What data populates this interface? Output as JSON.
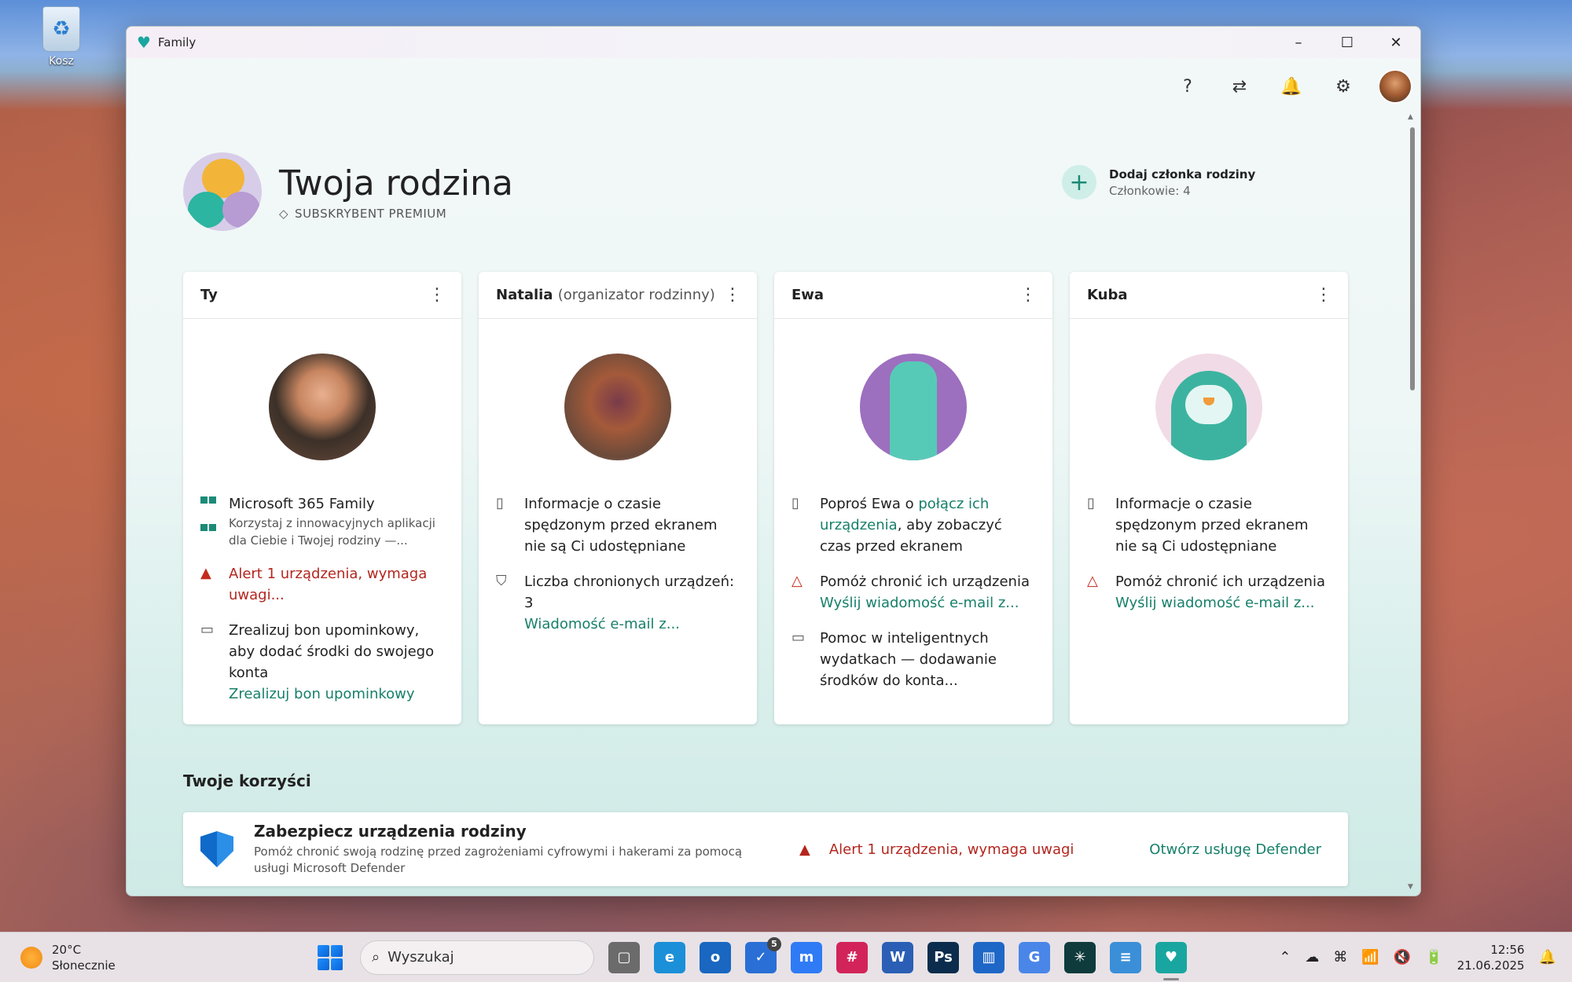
{
  "desktop": {
    "recycle_bin_label": "Kosz"
  },
  "window": {
    "title": "Family",
    "controls": {
      "minimize": "–",
      "maximize": "☐",
      "close": "✕"
    }
  },
  "toolbar": {
    "help_icon": "?",
    "switch_icon": "⇄",
    "bell_icon": "🔔",
    "settings_icon": "⚙"
  },
  "header": {
    "title": "Twoja rodzina",
    "subscription": "SUBSKRYBENT PREMIUM",
    "add_member": {
      "title": "Dodaj członka rodziny",
      "count": "Członkowie: 4",
      "icon": "+"
    }
  },
  "members": [
    {
      "name": "Ty",
      "role": "",
      "items": [
        {
          "title": "Microsoft 365 Family",
          "sub": "Korzystaj z innowacyjnych aplikacji dla Ciebie i Twojej rodziny —..."
        },
        {
          "alert": "Alert 1 urządzenia, wymaga uwagi..."
        },
        {
          "text": "Zrealizuj bon upominkowy, aby dodać środki do swojego konta",
          "link": "Zrealizuj bon upominkowy"
        }
      ]
    },
    {
      "name": "Natalia",
      "role": "(organizator rodzinny)",
      "items": [
        {
          "text": "Informacje o czasie spędzonym przed ekranem nie są Ci udostępniane"
        },
        {
          "text": "Liczba chronionych urządzeń: 3",
          "link": "Wiadomość e-mail z..."
        }
      ]
    },
    {
      "name": "Ewa",
      "role": "",
      "items": [
        {
          "pre": "Poproś Ewa o ",
          "link": "połącz ich urządzenia",
          "post": ", aby zobaczyć czas przed ekranem"
        },
        {
          "text": "Pomóż chronić ich urządzenia",
          "link": "Wyślij wiadomość e-mail z..."
        },
        {
          "text": "Pomoc w inteligentnych wydatkach — dodawanie środków do konta..."
        }
      ]
    },
    {
      "name": "Kuba",
      "role": "",
      "items": [
        {
          "text": "Informacje o czasie spędzonym przed ekranem nie są Ci udostępniane"
        },
        {
          "text": "Pomóż chronić ich urządzenia",
          "link": "Wyślij wiadomość e-mail z..."
        }
      ]
    }
  ],
  "benefits": {
    "title": "Twoje korzyści",
    "card": {
      "title": "Zabezpiecz urządzenia rodziny",
      "desc": "Pomóż chronić swoją rodzinę przed zagrożeniami cyfrowymi i hakerami za pomocą usługi Microsoft Defender",
      "alert": "Alert 1 urządzenia, wymaga uwagi",
      "link": "Otwórz usługę Defender"
    }
  },
  "taskbar": {
    "weather_temp": "20°C",
    "weather_desc": "Słonecznie",
    "search_placeholder": "Wyszukaj",
    "apps": [
      {
        "name": "task-view",
        "label": "▢",
        "color": "#6b6b6b"
      },
      {
        "name": "edge",
        "label": "e",
        "color": "#1b8fd8"
      },
      {
        "name": "outlook",
        "label": "o",
        "color": "#1967c1"
      },
      {
        "name": "todo",
        "label": "✓",
        "color": "#2a6fd6",
        "badge": "5"
      },
      {
        "name": "messenger",
        "label": "m",
        "color": "#2f7bf5"
      },
      {
        "name": "slack",
        "label": "#",
        "color": "#d2245a"
      },
      {
        "name": "word",
        "label": "W",
        "color": "#2b5fb5"
      },
      {
        "name": "photoshop",
        "label": "Ps",
        "color": "#0b2c4d"
      },
      {
        "name": "trello",
        "label": "▥",
        "color": "#1f67c7"
      },
      {
        "name": "translate",
        "label": "G",
        "color": "#4a86e8"
      },
      {
        "name": "perplexity",
        "label": "✳",
        "color": "#0f3b3c"
      },
      {
        "name": "notepad",
        "label": "≡",
        "color": "#3a8fd8"
      },
      {
        "name": "family",
        "label": "♥",
        "color": "#1aa6a0",
        "active": true
      }
    ],
    "tray_icons": [
      "⌃",
      "☁",
      "⌘",
      "📶",
      "🔇",
      "🔋"
    ],
    "time": "12:56",
    "date": "21.06.2025",
    "notification_icon": "🔔"
  }
}
